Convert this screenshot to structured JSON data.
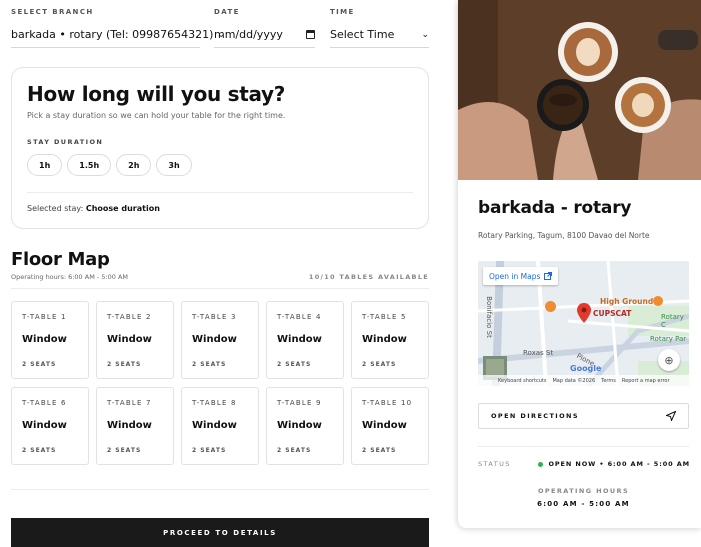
{
  "booking": {
    "branch_label": "SELECT BRANCH",
    "branch_value": "barkada • rotary (Tel: 09987654321)",
    "date_label": "DATE",
    "date_value": "mm/dd/yyyy",
    "time_label": "TIME",
    "time_value": "Select Time"
  },
  "duration": {
    "title": "How long will you stay?",
    "subtitle": "Pick a stay duration so we can hold your table for the right time.",
    "section_label": "STAY DURATION",
    "options": [
      "1h",
      "1.5h",
      "2h",
      "3h"
    ],
    "selected_prefix": "Selected stay:",
    "selected_value": "Choose duration"
  },
  "floor": {
    "title": "Floor Map",
    "hours": "Operating hours: 6:00 AM - 5:00 AM",
    "availability": "10/10 TABLES AVAILABLE",
    "tables": [
      {
        "id": "T-TABLE 1",
        "type": "Window",
        "seats": "2 SEATS"
      },
      {
        "id": "T-TABLE 2",
        "type": "Window",
        "seats": "2 SEATS"
      },
      {
        "id": "T-TABLE 3",
        "type": "Window",
        "seats": "2 SEATS"
      },
      {
        "id": "T-TABLE 4",
        "type": "Window",
        "seats": "2 SEATS"
      },
      {
        "id": "T-TABLE 5",
        "type": "Window",
        "seats": "2 SEATS"
      },
      {
        "id": "T-TABLE 6",
        "type": "Window",
        "seats": "2 SEATS"
      },
      {
        "id": "T-TABLE 7",
        "type": "Window",
        "seats": "2 SEATS"
      },
      {
        "id": "T-TABLE 8",
        "type": "Window",
        "seats": "2 SEATS"
      },
      {
        "id": "T-TABLE 9",
        "type": "Window",
        "seats": "2 SEATS"
      },
      {
        "id": "T-TABLE 10",
        "type": "Window",
        "seats": "2 SEATS"
      }
    ]
  },
  "proceed_label": "PROCEED TO DETAILS",
  "venue": {
    "name": "barkada - rotary",
    "address": "Rotary Parking, Tagum, 8100 Davao del Norte",
    "map": {
      "open_label": "Open in Maps",
      "place_high_ground": "High Ground",
      "place_cupscat": "CUPSCAT",
      "road_bonifacio": "Bonifacio St",
      "road_roxas": "Roxas St",
      "road_pioneer": "Pione",
      "label_rotary_c": "Rotary C",
      "label_rotary_par": "Rotary Par",
      "google_logo": "Google",
      "keyboard_shortcuts": "Keyboard shortcuts",
      "map_data": "Map data ©2026",
      "terms": "Terms",
      "report": "Report a map error"
    },
    "directions_label": "OPEN DIRECTIONS",
    "status_label": "STATUS",
    "status_value": "OPEN NOW • 6:00 AM - 5:00 AM",
    "operating_label": "OPERATING HOURS",
    "operating_value": "6:00 AM - 5:00 AM"
  },
  "colors": {
    "accent_dark": "#1a1a1a",
    "status_open": "#2bb24c",
    "map_pin": "#e03a2f",
    "map_poi": "#f28b30",
    "link_blue": "#1a6cd8"
  },
  "icons": {
    "branch_dropdown": "chevron-down-icon",
    "date_picker": "calendar-icon",
    "time_dropdown": "chevron-down-icon",
    "open_maps": "external-link-icon",
    "directions": "navigation-arrow-icon",
    "map_recenter": "recenter-icon",
    "map_pin": "map-pin-icon"
  }
}
